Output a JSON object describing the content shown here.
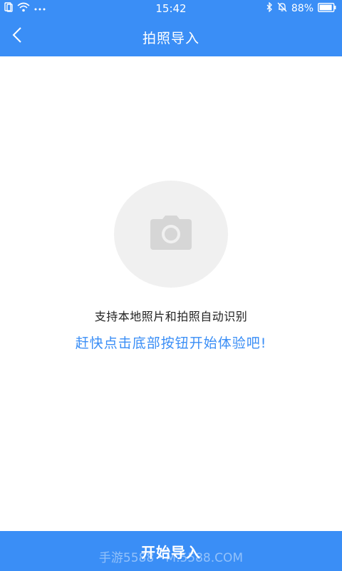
{
  "status_bar": {
    "time": "15:42",
    "battery": "88%",
    "icons_left": [
      "sim-icon",
      "wifi-icon",
      "more-dots-icon"
    ],
    "icons_right": [
      "bluetooth-icon",
      "alarm-off-icon",
      "battery-icon"
    ]
  },
  "header": {
    "title": "拍照导入",
    "back_icon": "chevron-left-icon"
  },
  "main": {
    "camera_icon": "camera-icon",
    "description": "支持本地照片和拍照自动识别",
    "hint": "赶快点击底部按钮开始体验吧!"
  },
  "footer": {
    "button_label": "开始导入",
    "watermark": "手游5588 · M.5588.COM"
  },
  "colors": {
    "primary": "#3a8ef6",
    "circle_bg": "#f0f0f0",
    "camera_gray": "#d6d6d6",
    "text_dark": "#222222"
  }
}
